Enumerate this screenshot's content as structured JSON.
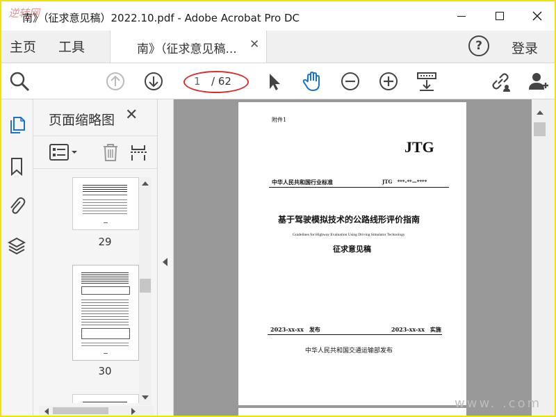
{
  "window": {
    "watermark": "逆转网",
    "title": "南》（征求意见稿）2022.10.pdf - Adobe Acrobat Pro DC"
  },
  "menu": {
    "home": "主页",
    "tools": "工具",
    "tab_label": "南》（征求意见稿...",
    "help": "?",
    "sign_in": "登录"
  },
  "toolbar": {
    "current_page": "1",
    "total_pages": "/ 62"
  },
  "panel": {
    "title": "页面缩略图",
    "thumbnails": [
      {
        "page": "29"
      },
      {
        "page": "30"
      }
    ]
  },
  "page": {
    "attachment": "附件1",
    "code": "JTG",
    "std_name": "中华人民共和国行业标准",
    "std_no": "JTG　***-**—****",
    "title_cn": "基于驾驶模拟技术的公路线形评价指南",
    "title_en": "Guidelines for Highway Evaluation Using Driving Simulator Technology",
    "draft": "征求意见稿",
    "publish": "2023-xx-xx　发布",
    "implement": "2023-xx-xx　实施",
    "publisher": "中华人民共和国交通运输部发布"
  },
  "footer_watermark": "www.    .com",
  "colors": {
    "accent_blue": "#1a73c8",
    "frame_yellow": "#f2e400",
    "page_box_red": "#d73030"
  },
  "icons": [
    "search-icon",
    "arrow-up-icon",
    "arrow-down-icon",
    "pointer-icon",
    "hand-icon",
    "zoom-out-icon",
    "zoom-in-icon",
    "scroll-mode-icon",
    "link-icon",
    "add-user-icon",
    "pages-icon",
    "bookmark-icon",
    "attachment-icon",
    "layers-icon",
    "options-icon",
    "delete-icon",
    "extract-icon"
  ]
}
